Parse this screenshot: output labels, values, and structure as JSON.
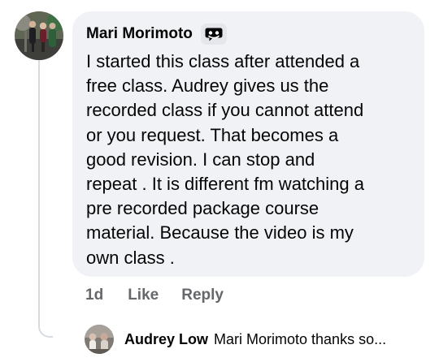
{
  "comment": {
    "author": "Mari Morimoto",
    "badge_icon": "chat-bubble-icon",
    "text_lines": [
      "I started this class after attended a",
      "free class.  Audrey gives us the",
      "recorded class if you cannot attend",
      "or you request. That becomes a",
      "good revision. I can stop and",
      "repeat . It is different fm watching a",
      "pre recorded package course",
      "material.  Because the video is my",
      "own class ."
    ],
    "time": "1d",
    "like_label": "Like",
    "reply_label": "Reply"
  },
  "reply_preview": {
    "author": "Audrey Low",
    "text": "Mari Morimoto thanks so..."
  },
  "colors": {
    "bubble_background": "#f0f2f5",
    "text_primary": "#050505",
    "text_secondary": "#65676b",
    "thread_line": "#d7dbe0"
  }
}
